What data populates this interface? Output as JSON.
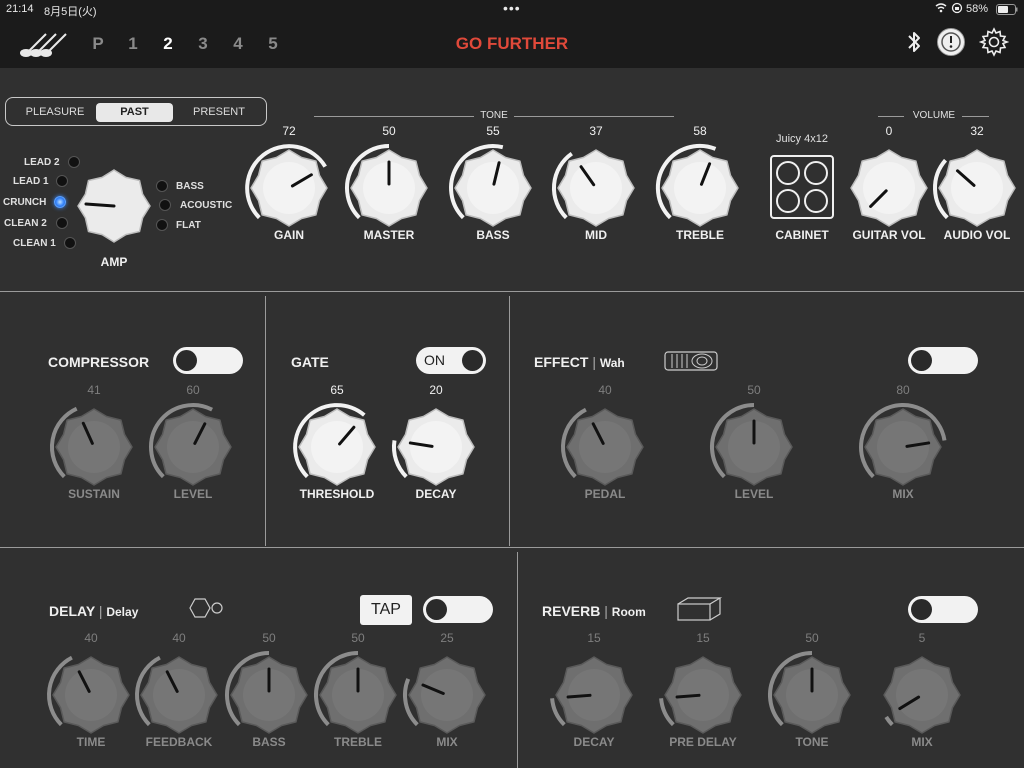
{
  "status_bar": {
    "time": "21:14",
    "date": "8月5日(火)",
    "battery": "58%"
  },
  "header": {
    "title": "GO FURTHER",
    "presets": [
      "P",
      "1",
      "2",
      "3",
      "4",
      "5"
    ],
    "active_preset": "2"
  },
  "amp": {
    "modes": [
      "PLEASURE",
      "PAST",
      "PRESENT"
    ],
    "selected_mode": "PAST",
    "label": "AMP",
    "left_options": [
      "LEAD 2",
      "LEAD 1",
      "CRUNCH",
      "CLEAN 2",
      "CLEAN 1"
    ],
    "right_options": [
      "BASS",
      "ACOUSTIC",
      "FLAT"
    ],
    "selected": "CRUNCH",
    "tone_group": "TONE",
    "volume_group": "VOLUME",
    "knobs": {
      "gain": {
        "label": "GAIN",
        "value": "72"
      },
      "master": {
        "label": "MASTER",
        "value": "50"
      },
      "bass": {
        "label": "BASS",
        "value": "55"
      },
      "mid": {
        "label": "MID",
        "value": "37"
      },
      "treble": {
        "label": "TREBLE",
        "value": "58"
      },
      "guitar_vol": {
        "label": "GUITAR VOL",
        "value": "0"
      },
      "audio_vol": {
        "label": "AUDIO VOL",
        "value": "32"
      }
    },
    "cabinet": {
      "name": "Juicy 4x12",
      "label": "CABINET"
    }
  },
  "compressor": {
    "title": "COMPRESSOR",
    "enabled": false,
    "knobs": {
      "sustain": {
        "label": "SUSTAIN",
        "value": "41"
      },
      "level": {
        "label": "LEVEL",
        "value": "60"
      }
    }
  },
  "gate": {
    "title": "GATE",
    "enabled": true,
    "toggle_text": "ON",
    "knobs": {
      "threshold": {
        "label": "THRESHOLD",
        "value": "65"
      },
      "decay": {
        "label": "DECAY",
        "value": "20"
      }
    }
  },
  "effect": {
    "title": "EFFECT",
    "type": "Wah",
    "enabled": false,
    "knobs": {
      "pedal": {
        "label": "PEDAL",
        "value": "40"
      },
      "level": {
        "label": "LEVEL",
        "value": "50"
      },
      "mix": {
        "label": "MIX",
        "value": "80"
      }
    }
  },
  "delay": {
    "title": "DELAY",
    "type": "Delay",
    "tap_label": "TAP",
    "enabled": false,
    "knobs": {
      "time": {
        "label": "TIME",
        "value": "40"
      },
      "feedback": {
        "label": "FEEDBACK",
        "value": "40"
      },
      "bass": {
        "label": "BASS",
        "value": "50"
      },
      "treble": {
        "label": "TREBLE",
        "value": "50"
      },
      "mix": {
        "label": "MIX",
        "value": "25"
      }
    }
  },
  "reverb": {
    "title": "REVERB",
    "type": "Room",
    "enabled": false,
    "knobs": {
      "decay": {
        "label": "DECAY",
        "value": "15"
      },
      "pre_delay": {
        "label": "PRE DELAY",
        "value": "15"
      },
      "tone": {
        "label": "TONE",
        "value": "50"
      },
      "mix": {
        "label": "MIX",
        "value": "5"
      }
    }
  },
  "colors": {
    "accent": "#e0493a",
    "led_on": "#3d8bff",
    "panel": "#303030",
    "bar": "#1b1b1b"
  },
  "icons": [
    "guitar-logo-icon",
    "bluetooth-icon",
    "tuner-icon",
    "gear-icon",
    "wifi-icon",
    "battery-icon",
    "wah-pedal-icon",
    "delay-type-icon",
    "room-icon"
  ]
}
